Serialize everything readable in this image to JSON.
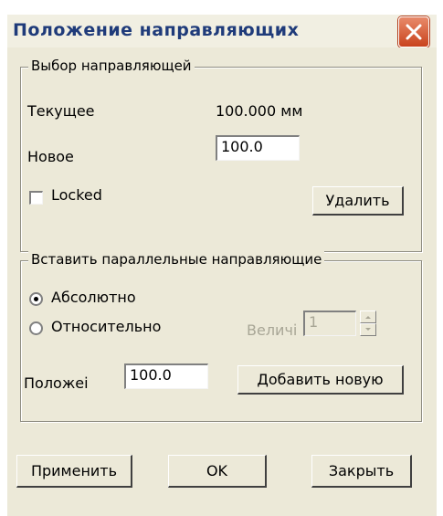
{
  "window": {
    "title": "Положение направляющих"
  },
  "guide_selection": {
    "legend": "Выбор направляющей",
    "current_label": "Текущее",
    "current_value": "100.000 мм",
    "new_label": "Новое",
    "new_value": "100.0",
    "locked_label": "Locked",
    "delete_label": "Удалить"
  },
  "insert_parallel": {
    "legend": "Вставить параллельные направляющие",
    "absolute_label": "Абсолютно",
    "relative_label": "Относительно",
    "magnitude_label": "Величі",
    "magnitude_value": "1",
    "position_label": "Положеі",
    "position_value": "100.0",
    "add_new_label": "Добавить новую"
  },
  "footer": {
    "apply_label": "Применить",
    "ok_label": "OK",
    "close_label": "Закрыть"
  }
}
